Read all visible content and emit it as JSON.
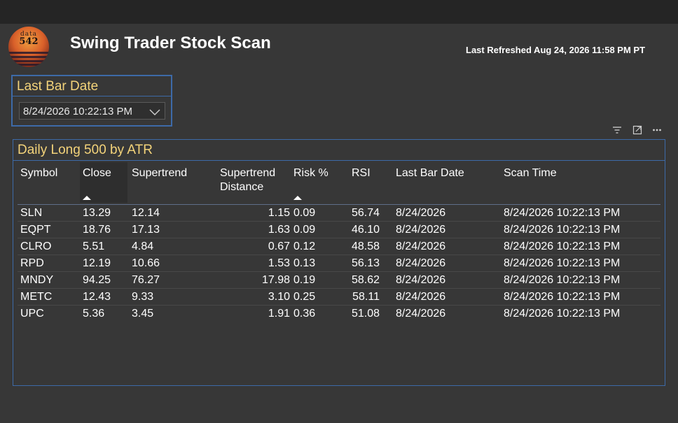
{
  "logo": {
    "line1": "data",
    "line2": "542"
  },
  "header": {
    "title": "Swing Trader Stock Scan",
    "last_refreshed": "Last Refreshed Aug 24, 2026 11:58 PM PT"
  },
  "slicer": {
    "title": "Last Bar Date",
    "value": "8/24/2026 10:22:13 PM"
  },
  "visual_icons": [
    "filter-icon",
    "expand-icon",
    "more-options-icon"
  ],
  "table": {
    "title": "Daily Long 500 by ATR",
    "columns": [
      "Symbol",
      "Close",
      "Supertrend",
      "Supertrend\nDistance",
      "Risk %",
      "RSI",
      "Last Bar Date",
      "Scan Time"
    ],
    "rows": [
      [
        "SLN",
        "13.29",
        "12.14",
        "1.15",
        "0.09",
        "56.74",
        "8/24/2026",
        "8/24/2026 10:22:13 PM"
      ],
      [
        "EQPT",
        "18.76",
        "17.13",
        "1.63",
        "0.09",
        "46.10",
        "8/24/2026",
        "8/24/2026 10:22:13 PM"
      ],
      [
        "CLRO",
        "5.51",
        "4.84",
        "0.67",
        "0.12",
        "48.58",
        "8/24/2026",
        "8/24/2026 10:22:13 PM"
      ],
      [
        "RPD",
        "12.19",
        "10.66",
        "1.53",
        "0.13",
        "56.13",
        "8/24/2026",
        "8/24/2026 10:22:13 PM"
      ],
      [
        "MNDY",
        "94.25",
        "76.27",
        "17.98",
        "0.19",
        "58.62",
        "8/24/2026",
        "8/24/2026 10:22:13 PM"
      ],
      [
        "METC",
        "12.43",
        "9.33",
        "3.10",
        "0.25",
        "58.11",
        "8/24/2026",
        "8/24/2026 10:22:13 PM"
      ],
      [
        "UPC",
        "5.36",
        "3.45",
        "1.91",
        "0.36",
        "51.08",
        "8/24/2026",
        "8/24/2026 10:22:13 PM"
      ]
    ]
  },
  "colors": {
    "accent_title": "#f3d37a",
    "border": "#3d6aa8",
    "background": "#373737"
  }
}
